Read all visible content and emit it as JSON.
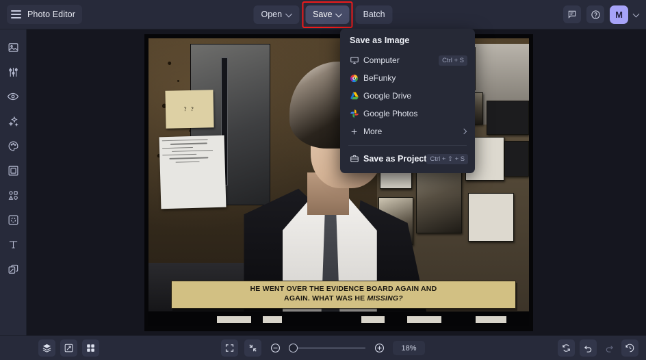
{
  "app": {
    "title": "Photo Editor",
    "accent_highlight": "#ef1b1b",
    "avatar_color": "#a7a3f8",
    "bar_color": "#272a3a",
    "canvas_color": "#15161f"
  },
  "topbar": {
    "menu_icon": "hamburger-icon",
    "open_label": "Open",
    "save_label": "Save",
    "batch_label": "Batch",
    "feedback_icon": "chat-icon",
    "help_icon": "help-circle-icon",
    "avatar_initial": "M",
    "account_caret_icon": "chevron-down-icon"
  },
  "sidebar": {
    "items": [
      {
        "name": "edit",
        "icon": "image-icon"
      },
      {
        "name": "adjust",
        "icon": "sliders-icon"
      },
      {
        "name": "retouch",
        "icon": "eye-icon"
      },
      {
        "name": "effects",
        "icon": "sparkles-icon"
      },
      {
        "name": "artsy",
        "icon": "palette-icon"
      },
      {
        "name": "frames",
        "icon": "frame-icon"
      },
      {
        "name": "graphics",
        "icon": "shapes-icon"
      },
      {
        "name": "overlays",
        "icon": "overlay-icon"
      },
      {
        "name": "text",
        "icon": "text-t-icon"
      },
      {
        "name": "layers",
        "icon": "duplicate-icon"
      }
    ]
  },
  "save_menu": {
    "title": "Save as Image",
    "items": [
      {
        "label": "Computer",
        "icon": "monitor-icon",
        "shortcut": "Ctrl + S",
        "submenu": false
      },
      {
        "label": "BeFunky",
        "icon": "befunky-logo-icon",
        "shortcut": "",
        "submenu": false
      },
      {
        "label": "Google Drive",
        "icon": "google-drive-icon",
        "shortcut": "",
        "submenu": false
      },
      {
        "label": "Google Photos",
        "icon": "google-photos-icon",
        "shortcut": "",
        "submenu": false
      },
      {
        "label": "More",
        "icon": "plus-icon",
        "shortcut": "",
        "submenu": true
      }
    ],
    "project": {
      "label": "Save as Project",
      "icon": "briefcase-icon",
      "shortcut": "Ctrl + ⇧ + S"
    }
  },
  "canvas": {
    "image_caption_line1": "HE WENT OVER THE EVIDENCE BOARD AGAIN AND",
    "image_caption_line2_plain": "AGAIN. WHAT WAS HE ",
    "image_caption_line2_em": "MISSING?",
    "note_yellow_text": "? ?"
  },
  "bottombar": {
    "left": [
      {
        "name": "layers",
        "icon": "layers-stack-icon"
      },
      {
        "name": "compare",
        "icon": "compare-split-icon"
      },
      {
        "name": "grid",
        "icon": "grid-four-icon"
      }
    ],
    "fit_icon": "fit-screen-icon",
    "collapse_icon": "collapse-arrows-icon",
    "zoom_out_icon": "minus-circle-icon",
    "zoom_in_icon": "plus-circle-icon",
    "zoom_value": "18%",
    "right": [
      {
        "name": "reset",
        "icon": "reset-rotate-icon"
      },
      {
        "name": "undo",
        "icon": "undo-arrow-icon"
      },
      {
        "name": "redo",
        "icon": "redo-arrow-icon"
      },
      {
        "name": "history",
        "icon": "clock-history-icon"
      }
    ]
  }
}
